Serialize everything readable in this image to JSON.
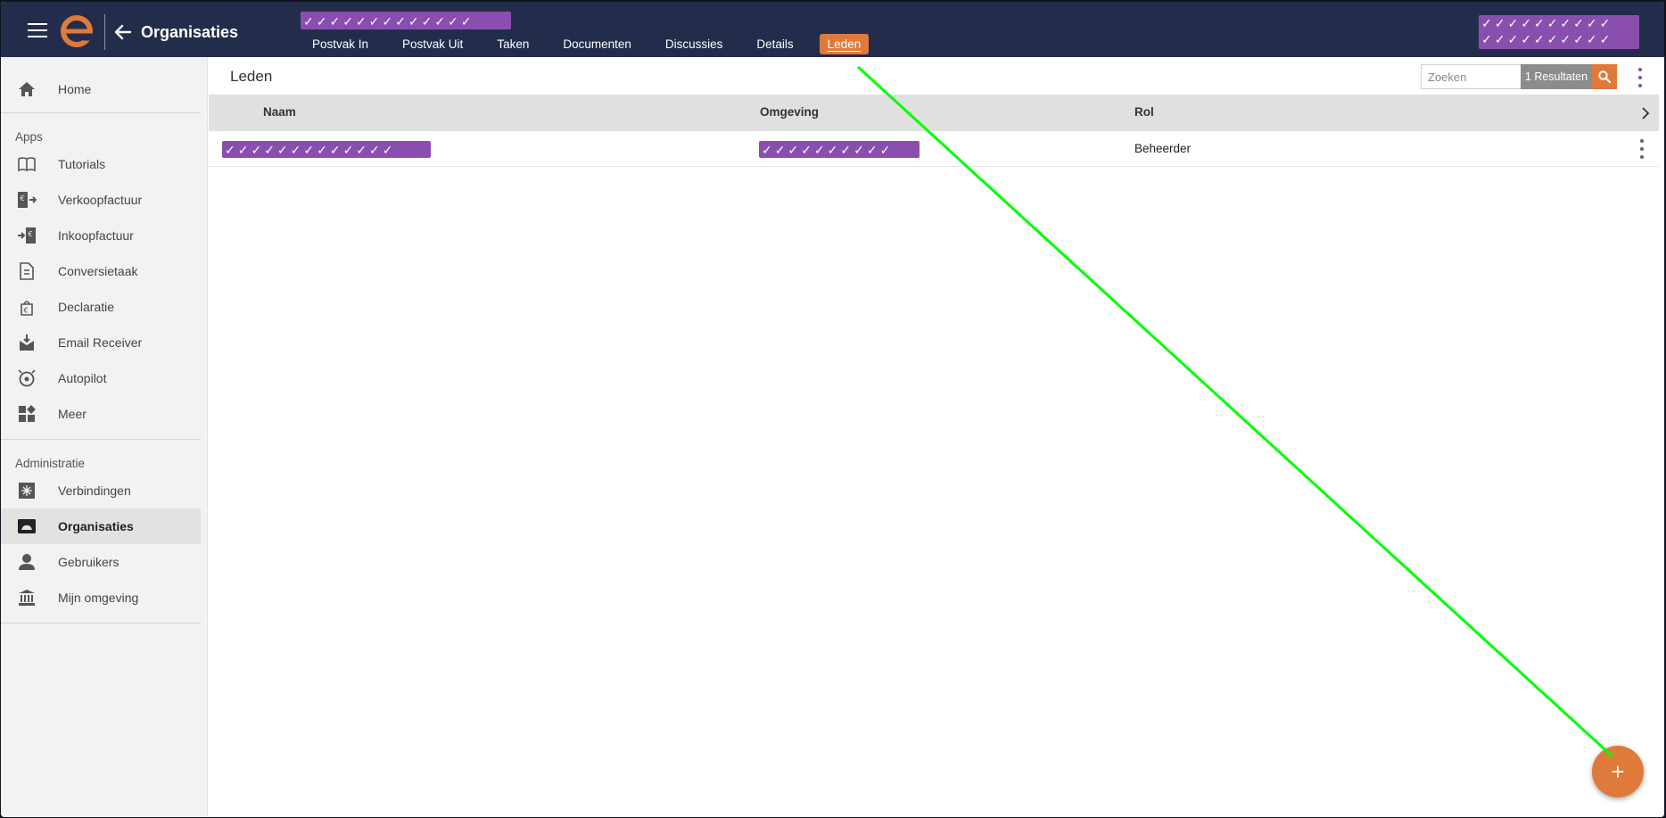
{
  "header": {
    "title": "Organisaties",
    "tabs": [
      {
        "label": "Postvak In"
      },
      {
        "label": "Postvak Uit"
      },
      {
        "label": "Taken"
      },
      {
        "label": "Documenten"
      },
      {
        "label": "Discussies"
      },
      {
        "label": "Details"
      },
      {
        "label": "Leden",
        "active": true
      }
    ]
  },
  "sidebar": {
    "home": {
      "label": "Home",
      "icon": "home-icon"
    },
    "apps_label": "Apps",
    "apps": [
      {
        "label": "Tutorials",
        "icon": "book-icon"
      },
      {
        "label": "Verkoopfactuur",
        "icon": "invoice-out-icon"
      },
      {
        "label": "Inkoopfactuur",
        "icon": "invoice-in-icon"
      },
      {
        "label": "Conversietaak",
        "icon": "conversion-icon"
      },
      {
        "label": "Declaratie",
        "icon": "expense-icon"
      },
      {
        "label": "Email Receiver",
        "icon": "email-receiver-icon"
      },
      {
        "label": "Autopilot",
        "icon": "autopilot-icon"
      },
      {
        "label": "Meer",
        "icon": "apps-grid-icon"
      }
    ],
    "admin_label": "Administratie",
    "admin": [
      {
        "label": "Verbindingen",
        "icon": "connections-icon"
      },
      {
        "label": "Organisaties",
        "icon": "organisations-icon",
        "active": true
      },
      {
        "label": "Gebruikers",
        "icon": "user-icon"
      },
      {
        "label": "Mijn omgeving",
        "icon": "institution-icon"
      }
    ]
  },
  "main": {
    "title": "Leden",
    "search": {
      "placeholder": "Zoeken",
      "value": ""
    },
    "result_count": "1 Resultaten",
    "columns": [
      "Naam",
      "Omgeving",
      "Rol"
    ],
    "rows": [
      {
        "naam": "[redacted]",
        "omgeving": "[redacted]",
        "rol": "Beheerder"
      }
    ],
    "fab_label": "+"
  },
  "colors": {
    "header_bg": "#232d4b",
    "accent": "#e07a3a",
    "redaction": "#8a4fae",
    "annotation_line": "#00ff00"
  }
}
